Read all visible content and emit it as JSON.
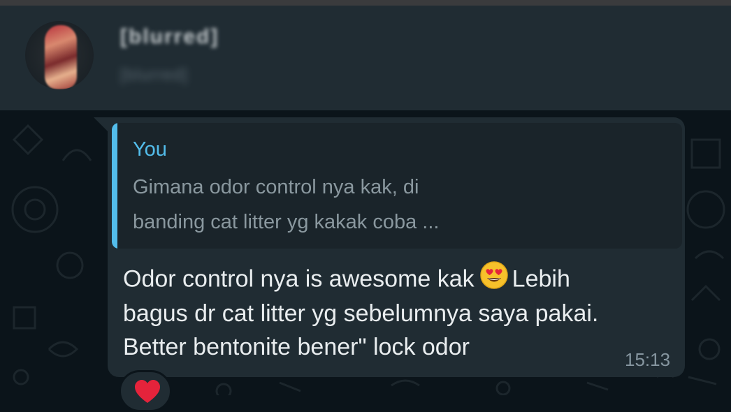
{
  "chat": {
    "contact_name": "[blurred]",
    "contact_status": "[blurred]"
  },
  "message": {
    "quote": {
      "author": "You",
      "line1": "Gimana odor control nya kak, di",
      "line2": "banding cat litter yg kakak coba ..."
    },
    "line1_before": "Odor control nya is awesome kak",
    "line1_after": "Lebih",
    "line2": "bagus dr cat litter yg sebelumnya saya pakai.",
    "line3": "Better bentonite bener\" lock odor",
    "emoji": "heart-eyes-emoji",
    "time": "15:13",
    "reaction": "red-heart-emoji"
  },
  "colors": {
    "chat_background": "#0b141a",
    "header_background": "#202c33",
    "bubble_background": "#202c33",
    "quote_accent": "#53bdeb",
    "primary_text": "#e9edef",
    "secondary_text": "#8696a0"
  }
}
